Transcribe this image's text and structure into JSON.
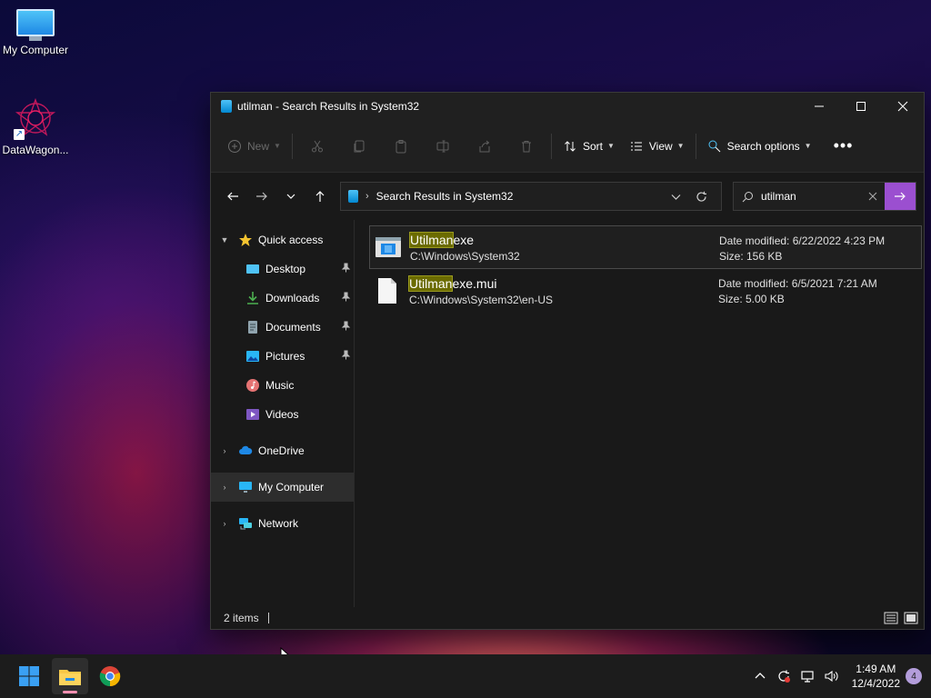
{
  "desktop": {
    "icons": [
      {
        "label": "My Computer"
      },
      {
        "label": "DataWagon..."
      }
    ]
  },
  "window": {
    "title": "utilman - Search Results in System32",
    "toolbar": {
      "new_label": "New",
      "sort_label": "Sort",
      "view_label": "View",
      "search_options_label": "Search options"
    },
    "address": {
      "crumb": "Search Results in System32"
    },
    "search": {
      "value": "utilman"
    },
    "nav": {
      "quick_access": "Quick access",
      "items": [
        {
          "label": "Desktop",
          "pinned": true
        },
        {
          "label": "Downloads",
          "pinned": true
        },
        {
          "label": "Documents",
          "pinned": true
        },
        {
          "label": "Pictures",
          "pinned": true
        },
        {
          "label": "Music",
          "pinned": false
        },
        {
          "label": "Videos",
          "pinned": false
        }
      ],
      "onedrive": "OneDrive",
      "my_computer": "My Computer",
      "network": "Network"
    },
    "results": [
      {
        "name_highlight": "Utilman",
        "name_rest": "exe",
        "path": "C:\\Windows\\System32",
        "date_modified": "Date modified: 6/22/2022 4:23 PM",
        "size": "Size: 156 KB"
      },
      {
        "name_highlight": "Utilman",
        "name_rest": "exe.mui",
        "path": "C:\\Windows\\System32\\en-US",
        "date_modified": "Date modified: 6/5/2021 7:21 AM",
        "size": "Size: 5.00 KB"
      }
    ],
    "status": {
      "items": "2 items"
    }
  },
  "taskbar": {
    "time": "1:49 AM",
    "date": "12/4/2022",
    "notifications": "4"
  },
  "colors": {
    "accent": "#9b4fd0",
    "highlight": "#6b6b00",
    "window_bg": "#191919"
  }
}
